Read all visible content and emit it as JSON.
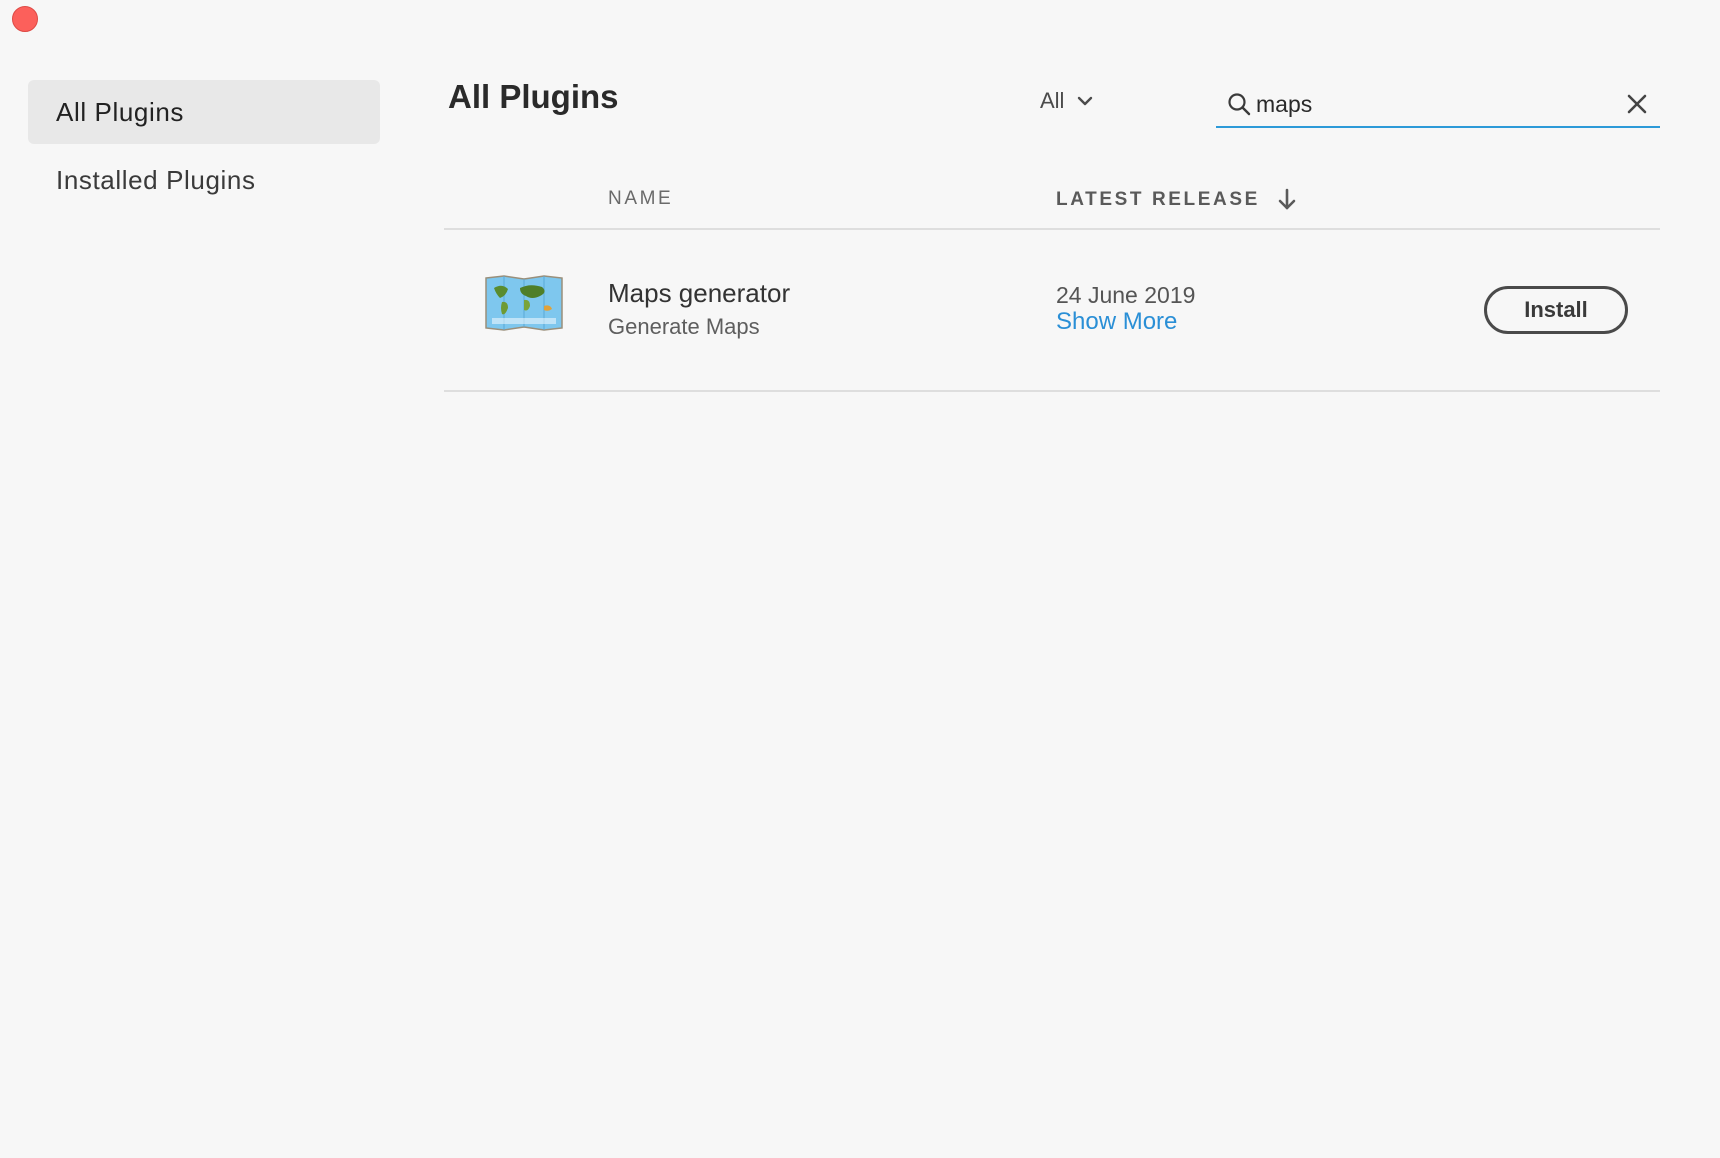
{
  "sidebar": {
    "items": [
      {
        "label": "All Plugins",
        "active": true
      },
      {
        "label": "Installed Plugins",
        "active": false
      }
    ]
  },
  "header": {
    "title": "All Plugins",
    "filter": {
      "selected": "All",
      "icon": "chevron-down-icon"
    },
    "search": {
      "value": "maps",
      "icon": "search-icon",
      "clear_icon": "close-icon"
    }
  },
  "table": {
    "columns": {
      "name": "NAME",
      "latest_release": "LATEST RELEASE",
      "sort_icon": "arrow-down-icon"
    },
    "rows": [
      {
        "icon": "world-map-icon",
        "name": "Maps generator",
        "description": "Generate Maps",
        "release_date": "24 June 2019",
        "show_more": "Show More",
        "action": "Install"
      }
    ]
  },
  "colors": {
    "accent": "#2d9ad8",
    "link": "#2a8fd6",
    "close_dot": "#fc605b",
    "active_nav_bg": "#e8e8e8"
  }
}
